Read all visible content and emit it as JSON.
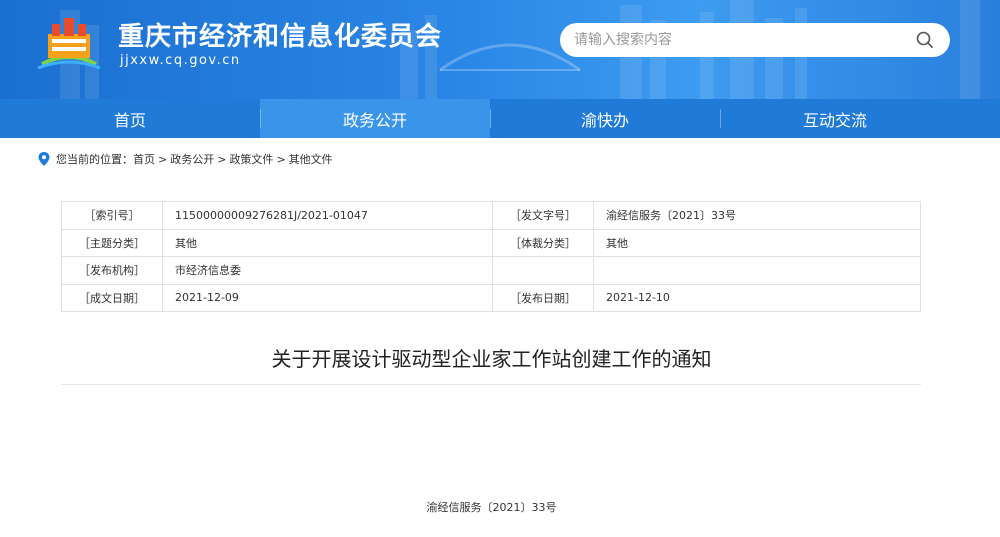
{
  "header": {
    "site_title": "重庆市经济和信息化委员会",
    "site_domain": "jjxxw.cq.gov.cn",
    "search_placeholder": "请输入搜索内容",
    "logo_icon": "government-building-logo",
    "search_icon": "search-icon"
  },
  "nav": {
    "items": [
      {
        "label": "首页"
      },
      {
        "label": "政务公开"
      },
      {
        "label": "渝快办"
      },
      {
        "label": "互动交流"
      }
    ],
    "active_index": 1
  },
  "breadcrumb": {
    "prefix": "您当前的位置：",
    "items": [
      "首页",
      "政务公开",
      "政策文件",
      "其他文件"
    ],
    "separator": ">"
  },
  "info_table": {
    "rows": [
      {
        "label1": "［索引号］",
        "value1": "11500000009276281J/2021-01047",
        "label2": "［发文字号］",
        "value2": "渝经信服务〔2021〕33号"
      },
      {
        "label1": "［主题分类］",
        "value1": "其他",
        "label2": "［体裁分类］",
        "value2": "其他"
      },
      {
        "label1": "［发布机构］",
        "value1": "市经济信息委",
        "label2": "",
        "value2": ""
      },
      {
        "label1": "［成文日期］",
        "value1": "2021-12-09",
        "label2": "［发布日期］",
        "value2": "2021-12-10"
      }
    ]
  },
  "document": {
    "title": "关于开展设计驱动型企业家工作站创建工作的通知",
    "number": "渝经信服务〔2021〕33号"
  },
  "colors": {
    "header_blue": "#2a86e6",
    "nav_blue": "#1f7ad8",
    "nav_active": "#3a95ea"
  }
}
